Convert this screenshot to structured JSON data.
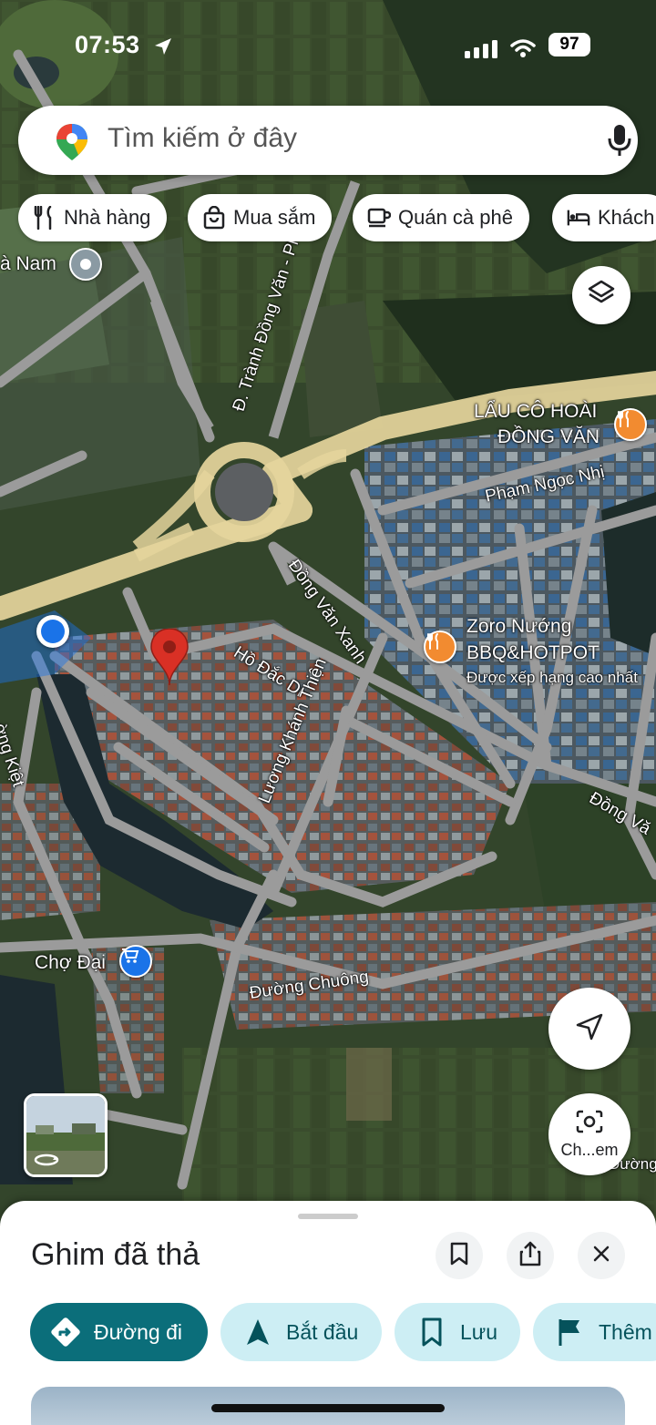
{
  "status_bar": {
    "time": "07:53",
    "battery": "97",
    "location_icon": "location-arrow-icon",
    "signal_icon": "cellular-signal-icon",
    "wifi_icon": "wifi-icon"
  },
  "search": {
    "placeholder": "Tìm kiếm ở đây",
    "logo_icon": "google-maps-pin-icon",
    "mic_icon": "microphone-icon"
  },
  "chips": [
    {
      "label": "Nhà hàng",
      "icon": "fork-knife-icon"
    },
    {
      "label": "Mua sắm",
      "icon": "shopping-bag-icon"
    },
    {
      "label": "Quán cà phê",
      "icon": "coffee-cup-icon"
    },
    {
      "label": "Khách",
      "icon": "bed-icon"
    }
  ],
  "map": {
    "labels": {
      "ha_nam": "à Nam",
      "tranh_dong_van": "Đ. Trành Đồng Văn - Phủ Lý",
      "lau_co_hoai_1": "LẨU CÔ HOÀI",
      "lau_co_hoai_2": "ĐỒNG VĂN",
      "pham_ngoc_nhi": "Phạm Ngọc Nhị",
      "dong_van_xanh": "Đồng Văn Xanh",
      "zoro_1": "Zoro Nướng",
      "zoro_2": "BBQ&HOTPOT",
      "zoro_rating": "Được xếp hạng cao nhất",
      "ho_dac_di": "Hồ Đắc Di",
      "luong_khanh_thien": "Lương Khánh Thiện",
      "duong_kiet": "ờng Kiệt",
      "dong_van_right": "Đồng Vă",
      "cho_dai": "Chợ Đại",
      "duong_chuong": "Đường Chuông",
      "cho_bottom": "Ch...em",
      "duong_bottom": "Đường"
    },
    "colors": {
      "highway": "#e8d9a2",
      "road": "#9a9a9a",
      "location_blue": "#1a73e8",
      "dropped_pin": "#d93025",
      "restaurant_poi": "#f28b30",
      "shopping_poi": "#1a73e8"
    }
  },
  "buttons": {
    "layers_icon": "layers-icon",
    "navigate_icon": "navigation-arrow-icon",
    "lens_icon": "camera-lens-icon",
    "lens_label": "Ch...em"
  },
  "sheet": {
    "title": "Ghim đã thả",
    "save_icon": "bookmark-icon",
    "share_icon": "share-icon",
    "close_icon": "close-icon",
    "actions": [
      {
        "label": "Đường đi",
        "icon": "directions-icon"
      },
      {
        "label": "Bắt đầu",
        "icon": "navigation-start-icon"
      },
      {
        "label": "Lưu",
        "icon": "bookmark-icon"
      },
      {
        "label": "Thêm",
        "icon": "flag-icon"
      }
    ]
  }
}
